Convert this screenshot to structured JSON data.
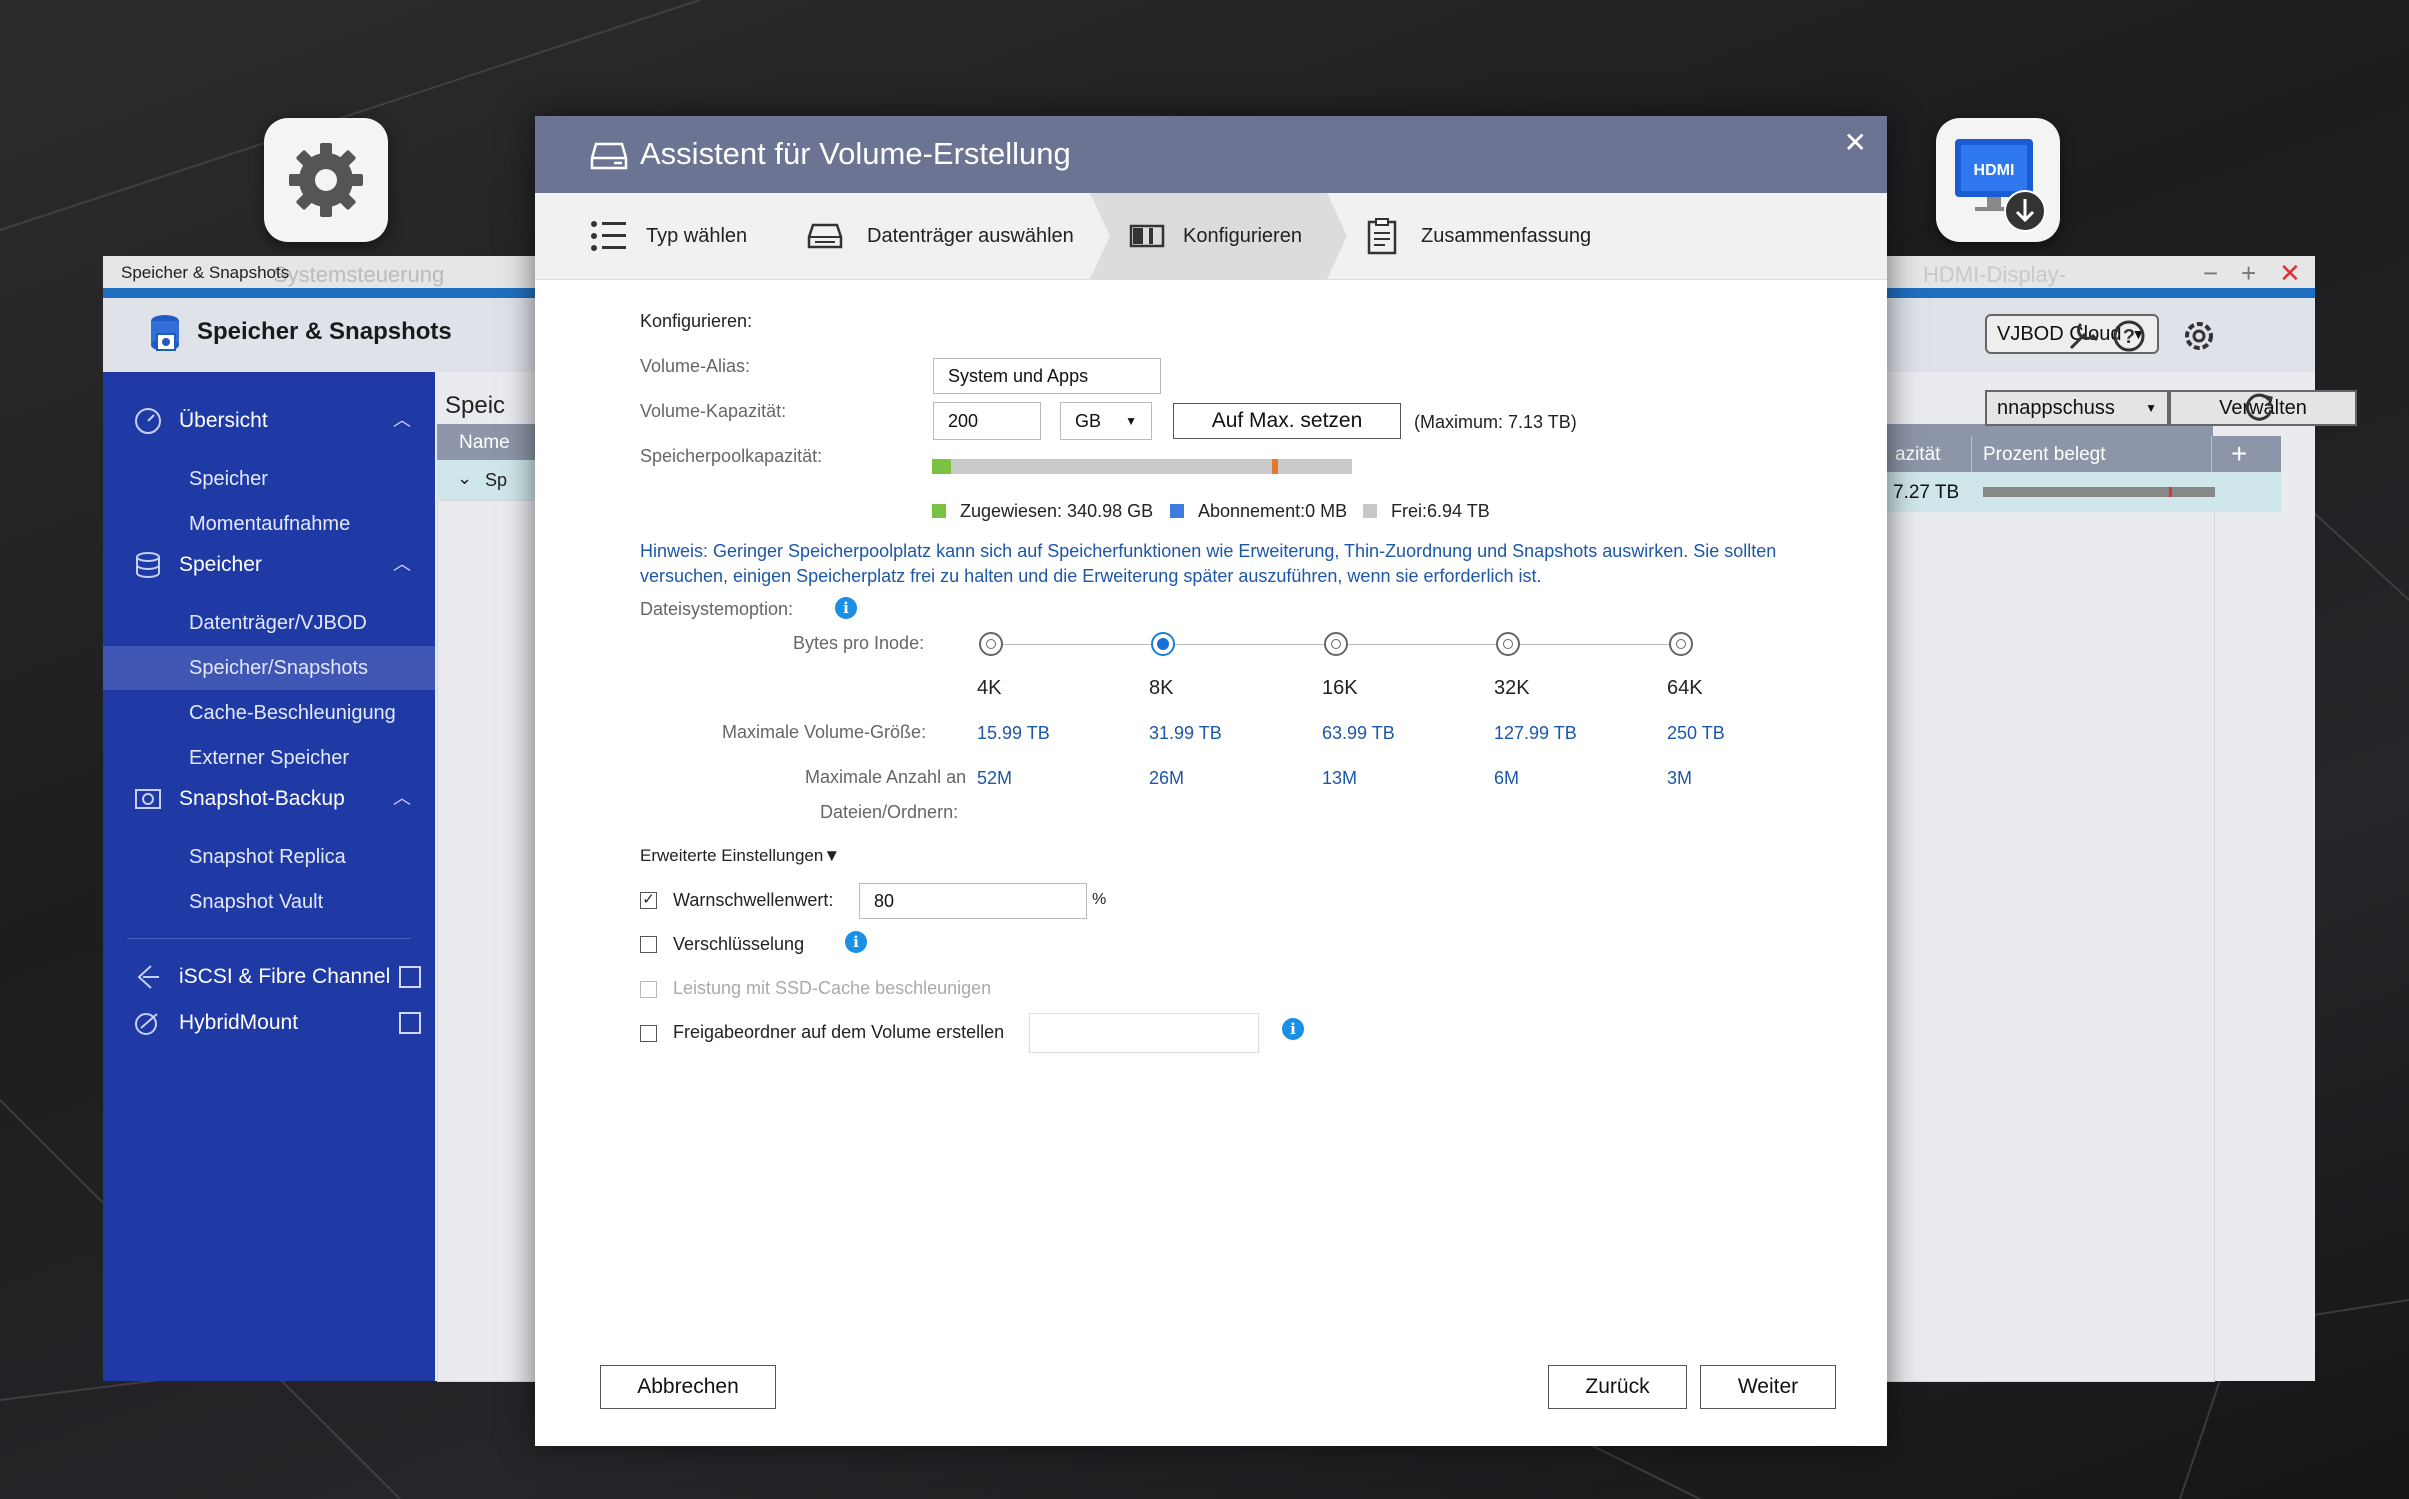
{
  "desktop": {
    "dock_left_icon": "gear-icon",
    "dock_right_icon": "hdmi-display-icon"
  },
  "app": {
    "window_title": "Speicher & Snapshots",
    "bg_title_left": "Systemsteuerung",
    "bg_title_right": "HDMI-Display-",
    "header_title": "Speicher & Snapshots",
    "sidebar": {
      "overview": "Übersicht",
      "overview_items": [
        "Speicher",
        "Momentaufnahme"
      ],
      "storage": "Speicher",
      "storage_items": [
        "Datenträger/VJBOD",
        "Speicher/Snapshots",
        "Cache-Beschleunigung",
        "Externer Speicher"
      ],
      "snapshot_backup": "Snapshot-Backup",
      "snapshot_items": [
        "Snapshot Replica",
        "Snapshot Vault"
      ],
      "iscsi": "iSCSI & Fibre Channel",
      "hybridmount": "HybridMount"
    },
    "main_title_partial": "Speic",
    "col_name_partial": "Name",
    "row_partial": "Sp",
    "right": {
      "vjbod": "VJBOD Cloud",
      "snapshot_dropdown": "nnappschuss",
      "manage": "Verwalten",
      "col_capacity": "azität",
      "col_percent": "Prozent belegt",
      "row_capacity": "7.27 TB",
      "row_percent_used": 0.8
    }
  },
  "dialog": {
    "title": "Assistent für Volume-Erstellung",
    "steps": [
      "Typ wählen",
      "Datenträger auswählen",
      "Konfigurieren",
      "Zusammenfassung"
    ],
    "active_step": 2,
    "section_title": "Konfigurieren:",
    "alias_label": "Volume-Alias:",
    "alias_value": "System und Apps",
    "capacity_label": "Volume-Kapazität:",
    "capacity_value": "200",
    "capacity_unit": "GB",
    "max_button": "Auf Max. setzen",
    "max_text": "(Maximum: 7.13 TB)",
    "pool_label": "Speicherpoolkapazität:",
    "pool_allocated_fraction": 0.045,
    "pool_marker_fraction": 0.81,
    "legend": {
      "allocated": "Zugewiesen:  340.98 GB",
      "subscription": "Abonnement:0 MB",
      "free": "Frei:6.94 TB"
    },
    "hint": "Hinweis: Geringer Speicherpoolplatz kann sich auf Speicherfunktionen wie Erweiterung, Thin-Zuordnung und Snapshots auswirken. Sie sollten versuchen, einigen Speicherplatz frei zu halten und die Erweiterung später auszuführen, wenn sie erforderlich ist.",
    "fs_option_label": "Dateisystemoption:",
    "inode_label": "Bytes pro Inode:",
    "inode_options": [
      "4K",
      "8K",
      "16K",
      "32K",
      "64K"
    ],
    "inode_selected": 1,
    "max_size_label": "Maximale Volume-Größe:",
    "max_sizes": [
      "15.99 TB",
      "31.99 TB",
      "63.99 TB",
      "127.99 TB",
      "250 TB"
    ],
    "max_files_label_1": "Maximale Anzahl an",
    "max_files_label_2": "Dateien/Ordnern:",
    "max_files": [
      "52M",
      "26M",
      "13M",
      "6M",
      "3M"
    ],
    "advanced_label": "Erweiterte Einstellungen▼",
    "warn_label": "Warnschwellenwert:",
    "warn_value": "80",
    "warn_unit": "%",
    "encryption_label": "Verschlüsselung",
    "ssd_label": "Leistung mit SSD-Cache beschleunigen",
    "share_label": "Freigabeordner auf dem Volume erstellen",
    "share_value": "",
    "cancel": "Abbrechen",
    "back": "Zurück",
    "next": "Weiter",
    "colors": {
      "header": "#6b7493",
      "allocated": "#7cc242",
      "subscription": "#3d7de0",
      "free": "#c8c8c8",
      "marker": "#e07a2f",
      "link": "#1c57a8"
    }
  }
}
